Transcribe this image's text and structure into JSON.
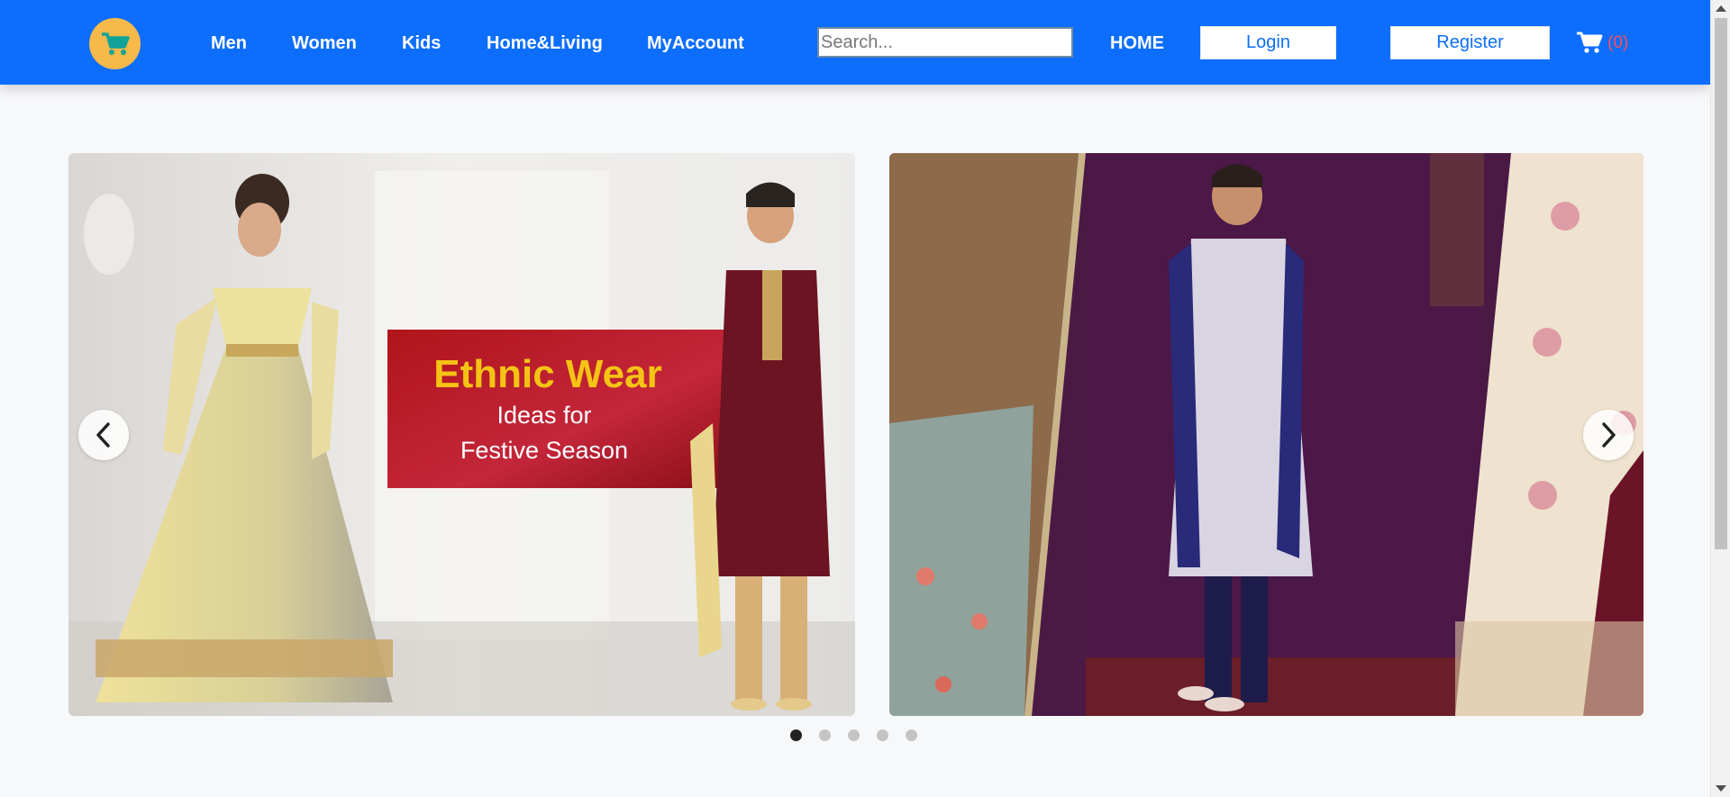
{
  "nav": {
    "links": [
      "Men",
      "Women",
      "Kids",
      "Home&Living",
      "MyAccount"
    ],
    "search_placeholder": "Search...",
    "home": "HOME",
    "login": "Login",
    "register": "Register",
    "cart_count": "(0)"
  },
  "carousel": {
    "slide1": {
      "title": "Ethnic Wear",
      "line1": "Ideas for",
      "line2": "Festive Season"
    },
    "dots": 5,
    "active_dot": 0
  },
  "colors": {
    "navbar": "#0d6efd",
    "logo_bg": "#f6b94a",
    "cart_count": "#ff4d5a"
  },
  "icons": [
    "shopping-cart-icon",
    "chevron-left-icon",
    "chevron-right-icon"
  ]
}
